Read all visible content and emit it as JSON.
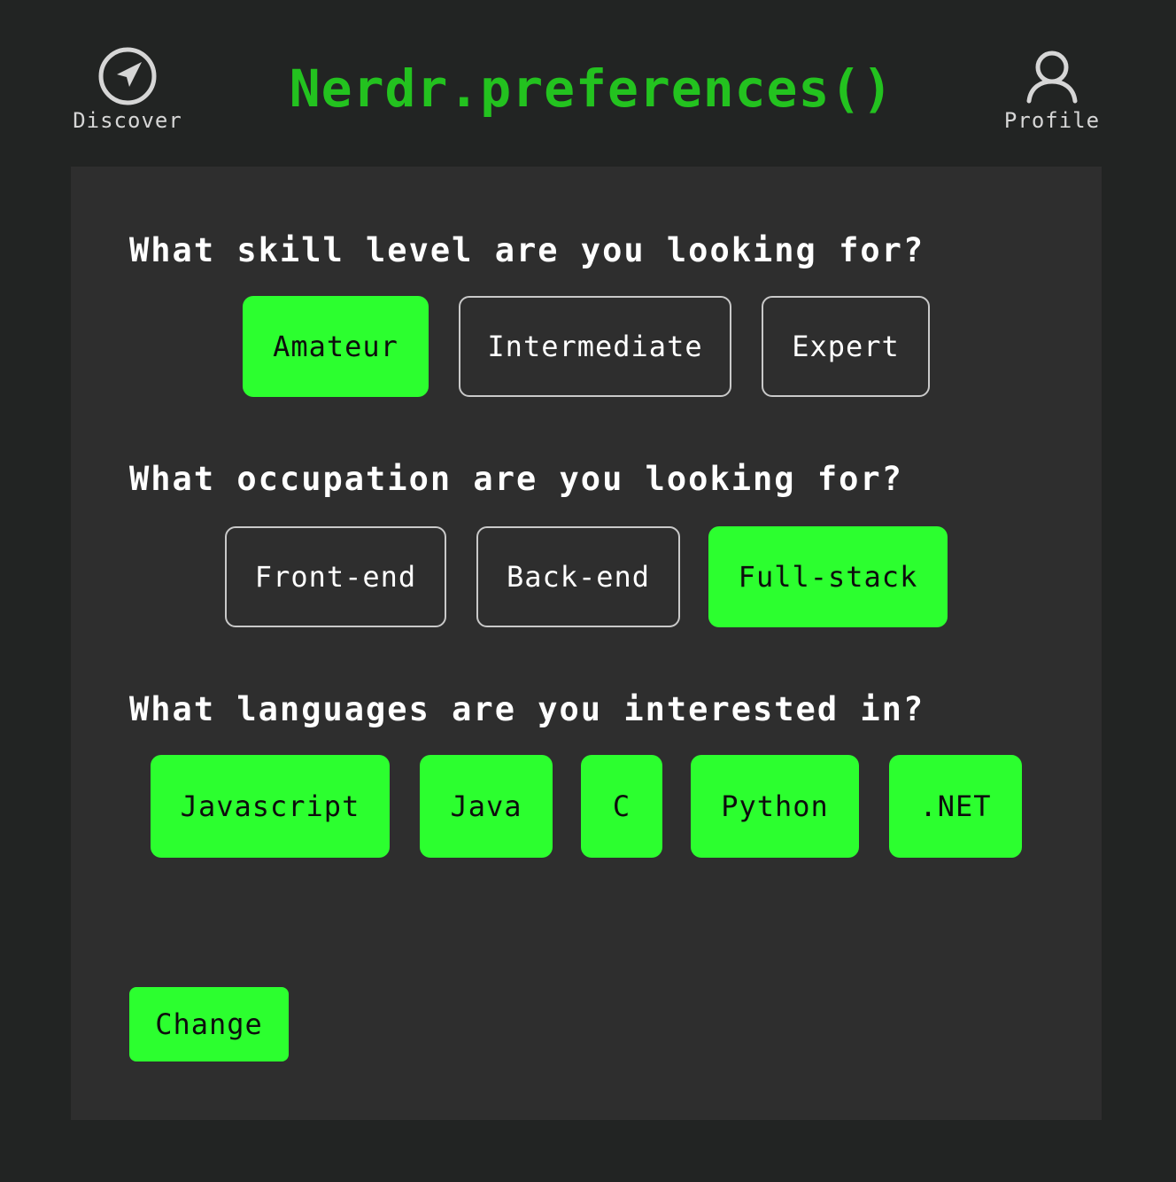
{
  "header": {
    "title": "Nerdr.preferences()",
    "discover": {
      "label": "Discover",
      "icon": "compass-navigation-icon"
    },
    "profile": {
      "label": "Profile",
      "icon": "user-icon"
    }
  },
  "colors": {
    "background": "#222423",
    "panel": "#2e2e2e",
    "accent": "#2cff2f",
    "title": "#23c21f",
    "text": "#ffffff",
    "nav_text": "#d6d6d6"
  },
  "skill": {
    "question": "What skill level are you looking for?",
    "options": [
      {
        "label": "Amateur",
        "selected": true
      },
      {
        "label": "Intermediate",
        "selected": false
      },
      {
        "label": "Expert",
        "selected": false
      }
    ]
  },
  "occupation": {
    "question": "What occupation are you looking for?",
    "options": [
      {
        "label": "Front-end",
        "selected": false
      },
      {
        "label": "Back-end",
        "selected": false
      },
      {
        "label": "Full-stack",
        "selected": true
      }
    ]
  },
  "languages": {
    "question": "What languages are you interested in?",
    "options": [
      {
        "label": "Javascript",
        "selected": true
      },
      {
        "label": "Java",
        "selected": true
      },
      {
        "label": "C",
        "selected": true
      },
      {
        "label": "Python",
        "selected": true
      },
      {
        "label": ".NET",
        "selected": true
      }
    ]
  },
  "actions": {
    "change_label": "Change"
  }
}
